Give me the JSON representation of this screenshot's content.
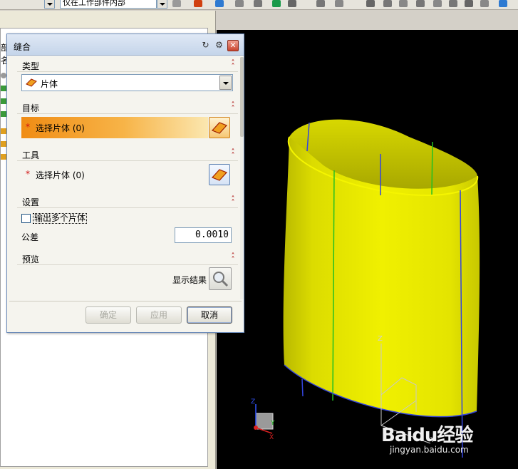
{
  "toolbar": {
    "filter_value": "仅在工作部件内部",
    "accent_icons": [
      "#d04010",
      "#2e7ad1",
      "#1a9a4a"
    ]
  },
  "navigator": {
    "partial_label": "部",
    "second_label": "名"
  },
  "dialog": {
    "title": "缝合",
    "groups": {
      "type": {
        "title": "类型",
        "selected": "片体"
      },
      "target": {
        "title": "目标",
        "selection": "选择片体 (0)"
      },
      "tool": {
        "title": "工具",
        "selection": "选择片体 (0)"
      },
      "settings": {
        "title": "设置",
        "output_multiple_label": "输出多个片体",
        "output_multiple_checked": false,
        "tolerance_label": "公差",
        "tolerance_value": "0.0010"
      },
      "preview": {
        "title": "预览",
        "show_result_label": "显示结果"
      }
    },
    "buttons": {
      "ok": "确定",
      "apply": "应用",
      "cancel": "取消"
    }
  },
  "viewport": {
    "background": "#000000",
    "body_color": "#e8e800",
    "triad_z_label": "Z",
    "triad_y_label": "Y",
    "triad_x_label": "X",
    "wcs_z_label": "Z",
    "wcs_y_label": "Y"
  },
  "watermark": {
    "logo": "Baidu经验",
    "url": "jingyan.baidu.com"
  },
  "colors": {
    "accent_orange": "#f08c14",
    "dialog_border": "#6c8bb9",
    "required_star": "#d01010"
  }
}
